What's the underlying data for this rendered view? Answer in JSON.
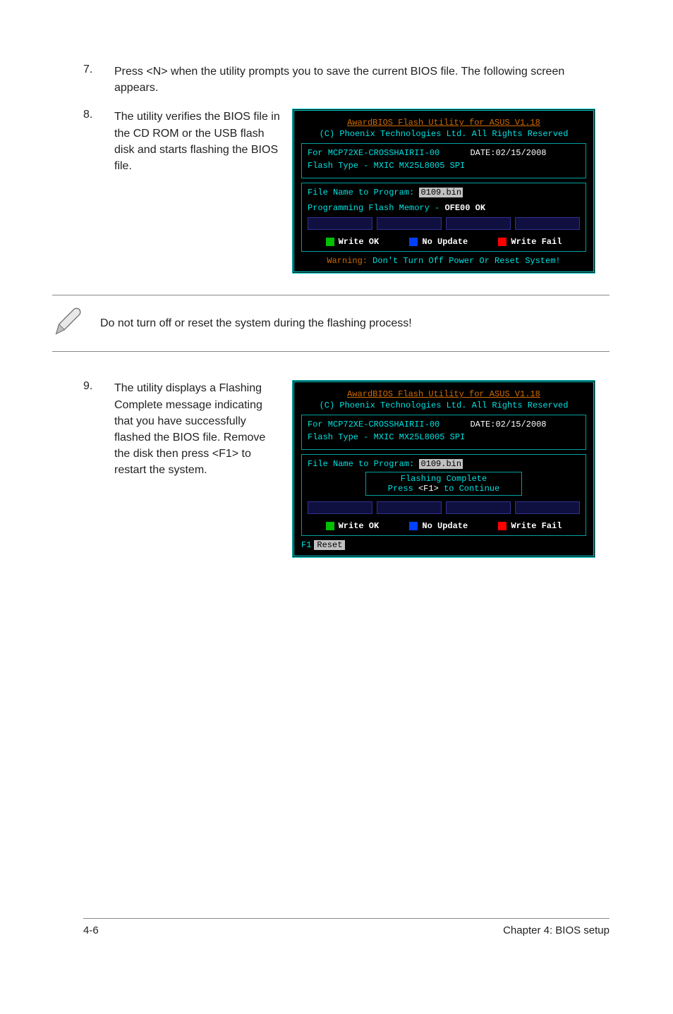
{
  "steps": {
    "s7": {
      "num": "7.",
      "text": "Press <N> when the utility prompts you to save the current BIOS file. The following screen appears."
    },
    "s8": {
      "num": "8.",
      "text": "The utility verifies the BIOS file in the CD ROM or the USB flash disk and starts flashing the BIOS file."
    },
    "s9": {
      "num": "9.",
      "text": "The utility displays a Flashing Complete message indicating that you have successfully flashed the BIOS file. Remove the disk then press <F1> to restart the system."
    }
  },
  "note": "Do not turn off or reset the system during the flashing process!",
  "terminal_common": {
    "title": "AwardBIOS Flash Utility for ASUS V1.18",
    "subtitle": "(C) Phoenix Technologies Ltd. All Rights Reserved",
    "for_line_prefix": "For MCP72XE-CROSSHAIRII-00",
    "date": "DATE:02/15/2008",
    "flash_type": "Flash Type - MXIC MX25L8005 SPI",
    "file_label": "File Name to Program:",
    "file_value": "0109.bin",
    "legend": {
      "ok": "Write OK",
      "noupdate": "No Update",
      "fail": "Write Fail"
    }
  },
  "terminal1": {
    "prog_prefix": "Programming Flash Memory - ",
    "prog_value": "OFE00 OK",
    "warn_label": "Warning:",
    "warn_text": " Don't Turn Off Power Or Reset System!"
  },
  "terminal2": {
    "popup_line1": "Flashing Complete",
    "popup_line2_a": "Press ",
    "popup_line2_b": "<F1>",
    "popup_line2_c": " to Continue",
    "f1_label": "F1",
    "f1_btn": "Reset"
  },
  "footer": {
    "left": "4-6",
    "right": "Chapter 4: BIOS setup"
  }
}
